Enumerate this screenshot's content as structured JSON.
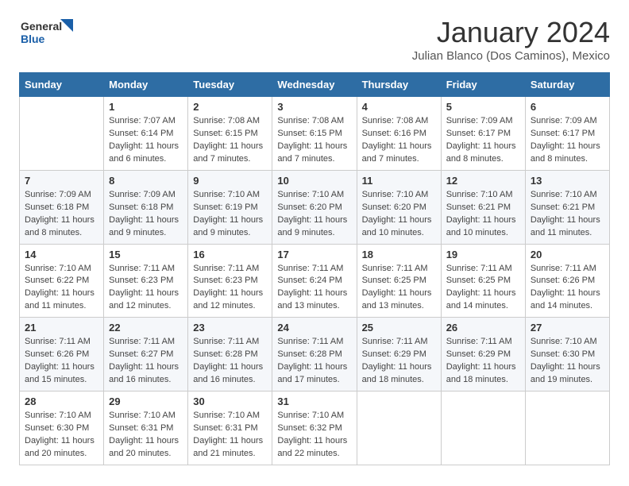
{
  "logo": {
    "general": "General",
    "blue": "Blue"
  },
  "header": {
    "month": "January 2024",
    "location": "Julian Blanco (Dos Caminos), Mexico"
  },
  "days_of_week": [
    "Sunday",
    "Monday",
    "Tuesday",
    "Wednesday",
    "Thursday",
    "Friday",
    "Saturday"
  ],
  "weeks": [
    [
      {
        "day": null
      },
      {
        "day": 1,
        "sunrise": "7:07 AM",
        "sunset": "6:14 PM",
        "daylight": "11 hours and 6 minutes."
      },
      {
        "day": 2,
        "sunrise": "7:08 AM",
        "sunset": "6:15 PM",
        "daylight": "11 hours and 7 minutes."
      },
      {
        "day": 3,
        "sunrise": "7:08 AM",
        "sunset": "6:15 PM",
        "daylight": "11 hours and 7 minutes."
      },
      {
        "day": 4,
        "sunrise": "7:08 AM",
        "sunset": "6:16 PM",
        "daylight": "11 hours and 7 minutes."
      },
      {
        "day": 5,
        "sunrise": "7:09 AM",
        "sunset": "6:17 PM",
        "daylight": "11 hours and 8 minutes."
      },
      {
        "day": 6,
        "sunrise": "7:09 AM",
        "sunset": "6:17 PM",
        "daylight": "11 hours and 8 minutes."
      }
    ],
    [
      {
        "day": 7,
        "sunrise": "7:09 AM",
        "sunset": "6:18 PM",
        "daylight": "11 hours and 8 minutes."
      },
      {
        "day": 8,
        "sunrise": "7:09 AM",
        "sunset": "6:18 PM",
        "daylight": "11 hours and 9 minutes."
      },
      {
        "day": 9,
        "sunrise": "7:10 AM",
        "sunset": "6:19 PM",
        "daylight": "11 hours and 9 minutes."
      },
      {
        "day": 10,
        "sunrise": "7:10 AM",
        "sunset": "6:20 PM",
        "daylight": "11 hours and 9 minutes."
      },
      {
        "day": 11,
        "sunrise": "7:10 AM",
        "sunset": "6:20 PM",
        "daylight": "11 hours and 10 minutes."
      },
      {
        "day": 12,
        "sunrise": "7:10 AM",
        "sunset": "6:21 PM",
        "daylight": "11 hours and 10 minutes."
      },
      {
        "day": 13,
        "sunrise": "7:10 AM",
        "sunset": "6:21 PM",
        "daylight": "11 hours and 11 minutes."
      }
    ],
    [
      {
        "day": 14,
        "sunrise": "7:10 AM",
        "sunset": "6:22 PM",
        "daylight": "11 hours and 11 minutes."
      },
      {
        "day": 15,
        "sunrise": "7:11 AM",
        "sunset": "6:23 PM",
        "daylight": "11 hours and 12 minutes."
      },
      {
        "day": 16,
        "sunrise": "7:11 AM",
        "sunset": "6:23 PM",
        "daylight": "11 hours and 12 minutes."
      },
      {
        "day": 17,
        "sunrise": "7:11 AM",
        "sunset": "6:24 PM",
        "daylight": "11 hours and 13 minutes."
      },
      {
        "day": 18,
        "sunrise": "7:11 AM",
        "sunset": "6:25 PM",
        "daylight": "11 hours and 13 minutes."
      },
      {
        "day": 19,
        "sunrise": "7:11 AM",
        "sunset": "6:25 PM",
        "daylight": "11 hours and 14 minutes."
      },
      {
        "day": 20,
        "sunrise": "7:11 AM",
        "sunset": "6:26 PM",
        "daylight": "11 hours and 14 minutes."
      }
    ],
    [
      {
        "day": 21,
        "sunrise": "7:11 AM",
        "sunset": "6:26 PM",
        "daylight": "11 hours and 15 minutes."
      },
      {
        "day": 22,
        "sunrise": "7:11 AM",
        "sunset": "6:27 PM",
        "daylight": "11 hours and 16 minutes."
      },
      {
        "day": 23,
        "sunrise": "7:11 AM",
        "sunset": "6:28 PM",
        "daylight": "11 hours and 16 minutes."
      },
      {
        "day": 24,
        "sunrise": "7:11 AM",
        "sunset": "6:28 PM",
        "daylight": "11 hours and 17 minutes."
      },
      {
        "day": 25,
        "sunrise": "7:11 AM",
        "sunset": "6:29 PM",
        "daylight": "11 hours and 18 minutes."
      },
      {
        "day": 26,
        "sunrise": "7:11 AM",
        "sunset": "6:29 PM",
        "daylight": "11 hours and 18 minutes."
      },
      {
        "day": 27,
        "sunrise": "7:10 AM",
        "sunset": "6:30 PM",
        "daylight": "11 hours and 19 minutes."
      }
    ],
    [
      {
        "day": 28,
        "sunrise": "7:10 AM",
        "sunset": "6:30 PM",
        "daylight": "11 hours and 20 minutes."
      },
      {
        "day": 29,
        "sunrise": "7:10 AM",
        "sunset": "6:31 PM",
        "daylight": "11 hours and 20 minutes."
      },
      {
        "day": 30,
        "sunrise": "7:10 AM",
        "sunset": "6:31 PM",
        "daylight": "11 hours and 21 minutes."
      },
      {
        "day": 31,
        "sunrise": "7:10 AM",
        "sunset": "6:32 PM",
        "daylight": "11 hours and 22 minutes."
      },
      {
        "day": null
      },
      {
        "day": null
      },
      {
        "day": null
      }
    ]
  ],
  "labels": {
    "sunrise": "Sunrise:",
    "sunset": "Sunset:",
    "daylight": "Daylight:"
  }
}
